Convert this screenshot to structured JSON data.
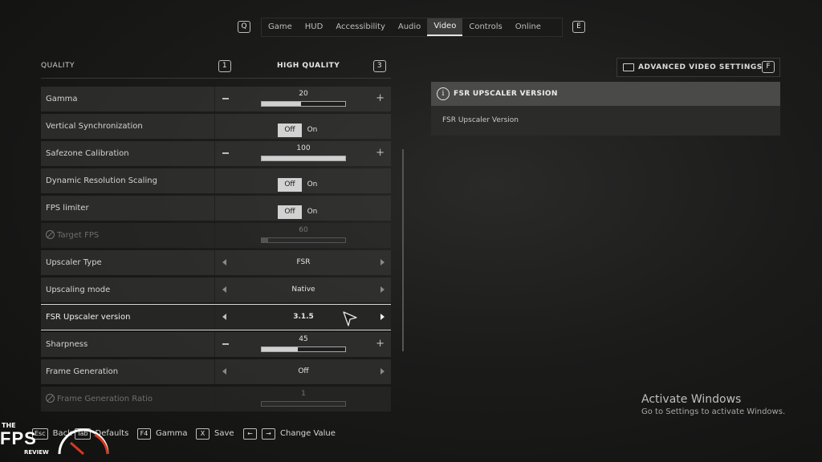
{
  "top_nav": {
    "left_key": "Q",
    "right_key": "E",
    "tabs": [
      "Game",
      "HUD",
      "Accessibility",
      "Audio",
      "Video",
      "Controls",
      "Online"
    ],
    "active_tab": "Video"
  },
  "quality": {
    "label": "QUALITY",
    "left_key": "1",
    "value": "HIGH QUALITY",
    "right_key": "3"
  },
  "settings": [
    {
      "name": "Gamma",
      "type": "slider",
      "value": "20",
      "fill": 0.47
    },
    {
      "name": "Vertical Synchronization",
      "type": "toggle",
      "off": "Off",
      "on": "On",
      "selected": "Off"
    },
    {
      "name": "Safezone Calibration",
      "type": "slider",
      "value": "100",
      "fill": 1.0
    },
    {
      "name": "Dynamic Resolution Scaling",
      "type": "toggle",
      "off": "Off",
      "on": "On",
      "selected": "Off"
    },
    {
      "name": "FPS limiter",
      "type": "toggle",
      "off": "Off",
      "on": "On",
      "selected": "Off"
    },
    {
      "name": "Target FPS",
      "type": "slider",
      "value": "60",
      "fill": 0.08,
      "disabled": true
    },
    {
      "name": "Upscaler Type",
      "type": "choice",
      "value": "FSR"
    },
    {
      "name": "Upscaling mode",
      "type": "choice",
      "value": "Native"
    },
    {
      "name": "FSR Upscaler version",
      "type": "choice",
      "value": "3.1.5",
      "selected": true
    },
    {
      "name": "Sharpness",
      "type": "slider",
      "value": "45",
      "fill": 0.43
    },
    {
      "name": "Frame Generation",
      "type": "choice",
      "value": "Off"
    },
    {
      "name": "Frame Generation Ratio",
      "type": "slider",
      "value": "1",
      "fill": 0.0,
      "disabled": true
    }
  ],
  "advanced": {
    "label": "ADVANCED VIDEO SETTINGS",
    "key": "F",
    "icon": "monitor-icon"
  },
  "info_panel": {
    "title": "FSR UPSCALER VERSION",
    "description": "FSR Upscaler Version"
  },
  "footer": {
    "back": {
      "key": "Esc",
      "label": "Back"
    },
    "defaults": {
      "key": "Tab",
      "label": "Defaults"
    },
    "gamma": {
      "key": "F4",
      "label": "Gamma"
    },
    "save": {
      "key": "X",
      "label": "Save"
    },
    "change": {
      "label": "Change Value"
    }
  },
  "windows_watermark": {
    "title": "Activate Windows",
    "subtitle": "Go to Settings to activate Windows."
  },
  "logo": {
    "the": "THE",
    "fps": "FPS",
    "review": "REVIEW"
  },
  "colors": {
    "accent": "#e6e6e6",
    "row_bg": "#3c3c3a",
    "background": "#1b1b1a"
  }
}
